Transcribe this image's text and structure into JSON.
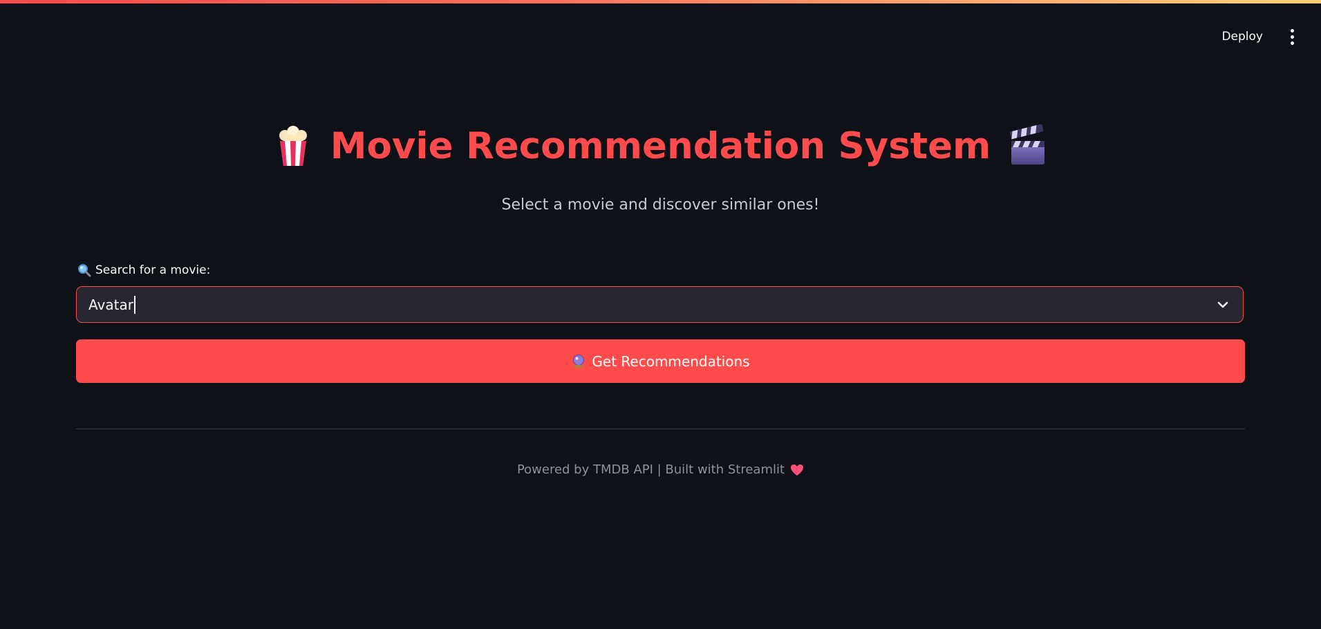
{
  "toolbar": {
    "deploy_label": "Deploy",
    "menu_icon": "kebab-menu-icon"
  },
  "header": {
    "title": "Movie Recommendation System",
    "title_left_icon": "popcorn-icon",
    "title_right_icon": "clapper-board-icon",
    "subtitle": "Select a movie and discover similar ones!"
  },
  "search": {
    "label_icon": "magnifying-glass-icon",
    "label": "Search for a movie:",
    "value": "Avatar"
  },
  "recommend_button": {
    "icon": "crystal-ball-icon",
    "label": "Get Recommendations"
  },
  "footer": {
    "text": "Powered by TMDB API | Built with Streamlit",
    "icon": "heart-icon"
  },
  "colors": {
    "background": "#0e1117",
    "accent": "#ff4b4b",
    "input_background": "#262730"
  }
}
